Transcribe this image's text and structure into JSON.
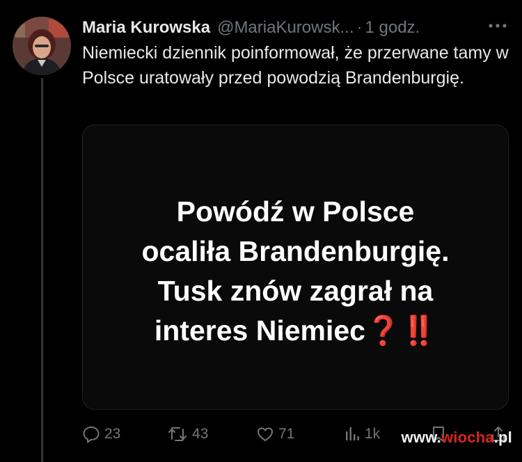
{
  "tweet": {
    "author_name": "Maria Kurowska",
    "author_handle": "@MariaKurowsk...",
    "separator": "·",
    "time": "1 godz.",
    "text": "Niemiecki dziennik poinformował, że przerwane tamy w Polsce uratowały przed powodzią Brandenburgię."
  },
  "media": {
    "lines": [
      "Powódź w Polsce",
      "ocaliła Brandenburgię.",
      "Tusk znów zagrał na",
      "interes Niemiec"
    ],
    "emoji_question": "❓",
    "emoji_bang": "‼️"
  },
  "actions": {
    "replies": "23",
    "retweets": "43",
    "likes": "71",
    "views": "1k"
  },
  "watermark": {
    "prefix": "www.",
    "accent": "wiocha",
    "suffix": ".pl"
  },
  "colors": {
    "background": "#000000",
    "text": "#e7e9ea",
    "muted": "#71767b",
    "emoji_red": "#e0201e"
  }
}
